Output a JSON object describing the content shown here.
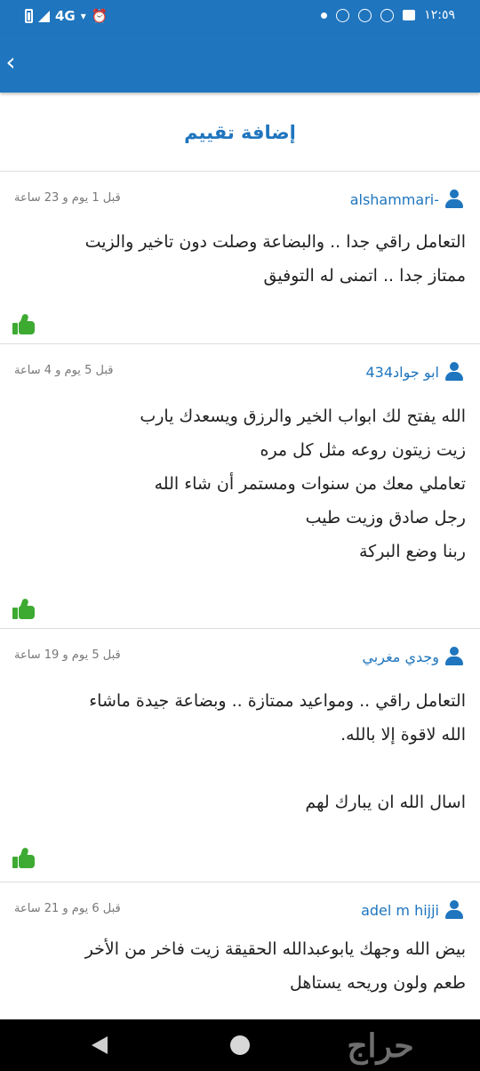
{
  "status_bar": {
    "network": "4G",
    "time": "١٢:٥٩"
  },
  "header": {
    "back_icon": "chevron-left-icon"
  },
  "add_rating_label": "إضافة تقييم",
  "reviews": [
    {
      "user": "alshammari-",
      "time": "قبل 1 يوم و 23 ساعة",
      "text": "التعامل راقي جدا .. والبضاعة وصلت دون تاخير والزيت\nممتاز جدا .. اتمنى له التوفيق"
    },
    {
      "user": "ابو جواد434",
      "time": "قبل 5 يوم و 4 ساعة",
      "text": "الله يفتح لك ابواب الخير والرزق ويسعدك يارب\nزيت زيتون روعه مثل كل مره\nتعاملي معك من سنوات ومستمر أن شاء الله\nرجل صادق وزيت طيب\nربنا وضع البركة"
    },
    {
      "user": "وجدي مغربي",
      "time": "قبل 5 يوم و 19 ساعة",
      "text": "التعامل راقي .. ومواعيد ممتازة .. وبضاعة جيدة ماشاء\nالله لاقوة إلا بالله.\n\nاسال الله ان يبارك لهم"
    },
    {
      "user": "adel m hijji",
      "time": "قبل 6 يوم و 21 ساعة",
      "text": "بيض الله وجهك يابوعبدالله الحقيقة زيت فاخر من الأخر\nطعم ولون وريحه يستاهل"
    }
  ],
  "nav": {
    "logo": "حراج"
  },
  "colors": {
    "primary": "#1f75be",
    "like_green": "#3daa32"
  }
}
